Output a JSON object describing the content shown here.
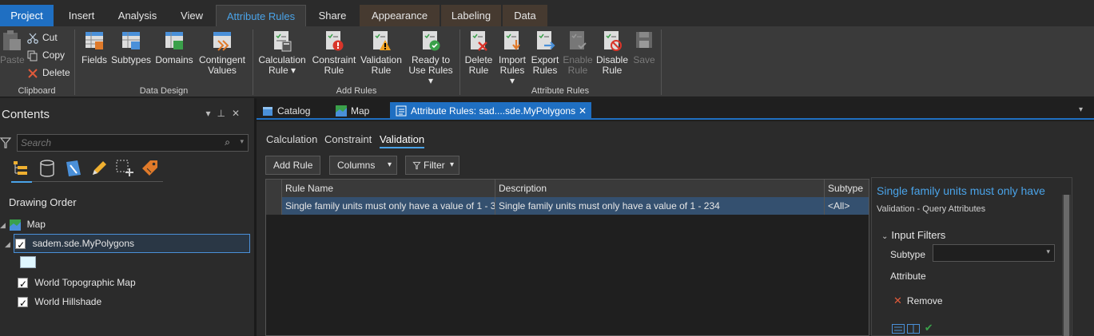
{
  "ribbon_tabs": [
    {
      "label": "Project"
    },
    {
      "label": "Insert"
    },
    {
      "label": "Analysis"
    },
    {
      "label": "View"
    },
    {
      "label": "Attribute Rules"
    },
    {
      "label": "Share"
    },
    {
      "label": "Appearance"
    },
    {
      "label": "Labeling"
    },
    {
      "label": "Data"
    }
  ],
  "clipboard": {
    "paste": "Paste",
    "cut": "Cut",
    "copy": "Copy",
    "delete": "Delete",
    "group": "Clipboard"
  },
  "data_design": {
    "fields": "Fields",
    "subtypes": "Subtypes",
    "domains": "Domains",
    "contingent_1": "Contingent",
    "contingent_2": "Values",
    "group": "Data Design"
  },
  "add_rules": {
    "calc_1": "Calculation",
    "calc_2": "Rule",
    "constraint_1": "Constraint",
    "constraint_2": "Rule",
    "validation_1": "Validation",
    "validation_2": "Rule",
    "ready_1": "Ready to",
    "ready_2": "Use Rules",
    "group": "Add Rules"
  },
  "attribute_rules_group": {
    "delete_1": "Delete",
    "delete_2": "Rule",
    "import_1": "Import",
    "import_2": "Rules",
    "export_1": "Export",
    "export_2": "Rules",
    "enable_1": "Enable",
    "enable_2": "Rule",
    "disable_1": "Disable",
    "disable_2": "Rule",
    "save": "Save",
    "group": "Attribute Rules"
  },
  "contents": {
    "title": "Contents",
    "search_placeholder": "Search",
    "drawing_order": "Drawing Order",
    "map": "Map",
    "layers": [
      {
        "name": "sadem.sde.MyPolygons"
      },
      {
        "name": "World Topographic Map"
      },
      {
        "name": "World Hillshade"
      }
    ]
  },
  "doc_tabs": [
    {
      "label": "Catalog"
    },
    {
      "label": "Map"
    },
    {
      "label": "Attribute Rules: sad....sde.MyPolygons"
    }
  ],
  "rule_type_tabs": {
    "calculation": "Calculation",
    "constraint": "Constraint",
    "validation": "Validation"
  },
  "toolbar": {
    "add_rule": "Add Rule",
    "columns": "Columns",
    "filter": "Filter"
  },
  "table": {
    "headers": [
      "Rule Name",
      "Description",
      "Subtype"
    ],
    "rows": [
      [
        "Single family units must only have a value of 1 - 3",
        "Single family units must only have a value of 1 - 234",
        "<All>"
      ]
    ]
  },
  "rule_panel": {
    "title": "Single family units must only have",
    "subtitle": "Validation - Query Attributes",
    "section": "Input Filters",
    "subtype_label": "Subtype",
    "attribute_label": "Attribute",
    "remove_label": "Remove"
  },
  "colors": {
    "accent": "#1f6fc2",
    "link": "#4aa3e8",
    "selected_row": "#34506f"
  }
}
